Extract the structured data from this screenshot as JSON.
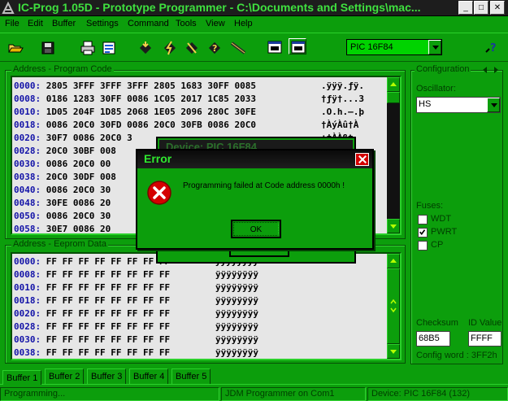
{
  "window": {
    "title": "IC-Prog 1.05D - Prototype Programmer - C:\\Documents and Settings\\mac...",
    "minimize_glyph": "_",
    "maximize_glyph": "□",
    "close_glyph": "✕"
  },
  "menu": [
    "File",
    "Edit",
    "Buffer",
    "Settings",
    "Command",
    "Tools",
    "View",
    "Help"
  ],
  "toolbar": {
    "icons": [
      "open-folder-icon",
      "save-disk-icon",
      "print-icon",
      "settings-icon",
      "read-chip-icon",
      "program-chip-icon",
      "erase-chip-icon",
      "verify-chip-icon",
      "blank-check-icon",
      "window-icon",
      "active-window-icon"
    ],
    "device": "PIC 16F84",
    "help_icon": "help-icon"
  },
  "code_panel": {
    "label": "Address - Program Code",
    "rows": [
      {
        "addr": "0000:",
        "data": "2805 3FFF 3FFF 3FFF 2805 1683 30FF 0085",
        "ascii": ".ÿÿÿ.ƒÿ."
      },
      {
        "addr": "0008:",
        "data": "0186 1283 30FF 0086 1C05 2017 1C85 2033",
        "ascii": "†ƒÿ†...3"
      },
      {
        "addr": "0010:",
        "data": "1D05 204F 1D85 2068 1E05 2096 280C 30FE",
        "ascii": ".O.h.–.þ"
      },
      {
        "addr": "0018:",
        "data": "0086 20C0 30FD 0086 20C0 30FB 0086 20C0",
        "ascii": "†ÀýÀû†À"
      },
      {
        "addr": "0020:",
        "data": "30F7 0086 20C0 3",
        "ascii": "÷†ÀÀßt"
      },
      {
        "addr": "0028:",
        "data": "20C0 30BF 008",
        "ascii": ""
      },
      {
        "addr": "0030:",
        "data": "0086 20C0 00",
        "ascii": ""
      },
      {
        "addr": "0038:",
        "data": "20C0 30DF 008",
        "ascii": ""
      },
      {
        "addr": "0040:",
        "data": "0086 20C0 30",
        "ascii": ""
      },
      {
        "addr": "0048:",
        "data": "30FE 0086 20",
        "ascii": ""
      },
      {
        "addr": "0050:",
        "data": "0086 20C0 30",
        "ascii": ""
      },
      {
        "addr": "0058:",
        "data": "30E7 0086 20",
        "ascii": ""
      }
    ]
  },
  "eeprom_panel": {
    "label": "Address - Eeprom Data",
    "rows": [
      {
        "addr": "0000:",
        "data": "FF FF FF FF FF FF FF FF",
        "ascii": "ÿÿÿÿÿÿÿÿ"
      },
      {
        "addr": "0008:",
        "data": "FF FF FF FF FF FF FF FF",
        "ascii": "ÿÿÿÿÿÿÿÿ"
      },
      {
        "addr": "0010:",
        "data": "FF FF FF FF FF FF FF FF",
        "ascii": "ÿÿÿÿÿÿÿÿ"
      },
      {
        "addr": "0018:",
        "data": "FF FF FF FF FF FF FF FF",
        "ascii": "ÿÿÿÿÿÿÿÿ"
      },
      {
        "addr": "0020:",
        "data": "FF FF FF FF FF FF FF FF",
        "ascii": "ÿÿÿÿÿÿÿÿ"
      },
      {
        "addr": "0028:",
        "data": "FF FF FF FF FF FF FF FF",
        "ascii": "ÿÿÿÿÿÿÿÿ"
      },
      {
        "addr": "0030:",
        "data": "FF FF FF FF FF FF FF FF",
        "ascii": "ÿÿÿÿÿÿÿÿ"
      },
      {
        "addr": "0038:",
        "data": "FF FF FF FF FF FF FF FF",
        "ascii": "ÿÿÿÿÿÿÿÿ"
      }
    ]
  },
  "config": {
    "label": "Configuration",
    "oscillator_label": "Oscillator:",
    "oscillator_value": "HS",
    "fuses_label": "Fuses:",
    "fuses": [
      {
        "name": "WDT",
        "checked": false
      },
      {
        "name": "PWRT",
        "checked": true
      },
      {
        "name": "CP",
        "checked": false
      }
    ],
    "checksum_label": "Checksum",
    "checksum_value": "68B5",
    "id_label": "ID Value",
    "id_value": "FFFF",
    "config_word": "Config word : 3FF2h"
  },
  "tabs": [
    "Buffer 1",
    "Buffer 2",
    "Buffer 3",
    "Buffer 4",
    "Buffer 5"
  ],
  "status": {
    "left": "Programming...",
    "middle": "JDM Programmer on Com1",
    "right": "Device: PIC 16F84   (132)"
  },
  "device_dialog": {
    "title": "Device: PIC 16F84"
  },
  "error_dialog": {
    "title": "Error",
    "message": "Programming failed at Code address 0000h !",
    "ok_label": "OK"
  },
  "colors": {
    "background": "#0c9e0c",
    "title_text": "#3fe03f",
    "address_text": "#1414a8",
    "error_red": "#d40000"
  }
}
